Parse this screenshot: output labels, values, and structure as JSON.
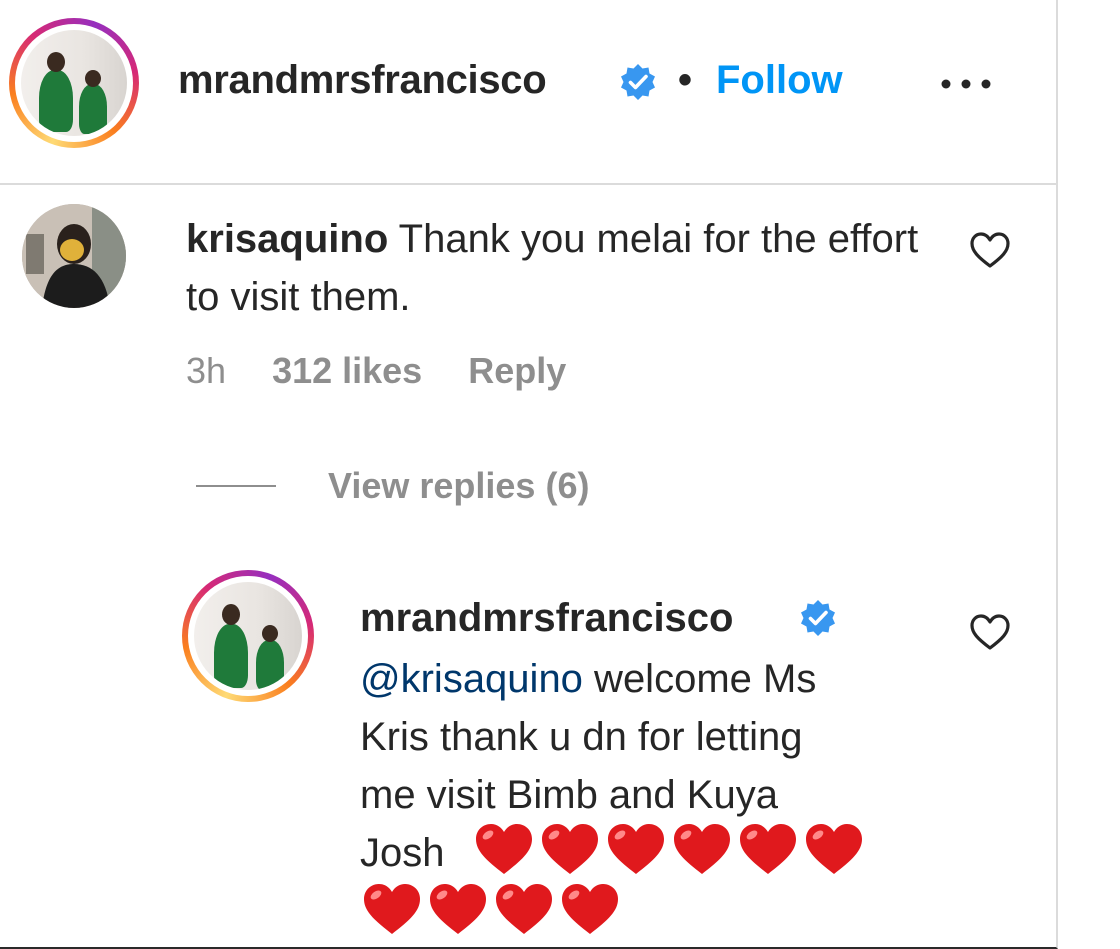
{
  "header": {
    "username": "mrandmrsfrancisco",
    "separator": "•",
    "follow_label": "Follow",
    "more_icon": "more-horizontal-icon"
  },
  "comment": {
    "username": "krisaquino",
    "text": "Thank you melai for the effort to visit them.",
    "time": "3h",
    "likes": "312 likes",
    "reply_label": "Reply",
    "view_replies_label": "View replies (6)"
  },
  "reply": {
    "username": "mrandmrsfrancisco",
    "mention": "@krisaquino",
    "text_line1_rest": " welcome Ms",
    "text_line2": "Kris thank u dn for letting",
    "text_line3": "me visit Bimb and Kuya",
    "text_line4": "Josh",
    "heart_count": 10
  },
  "colors": {
    "link_blue": "#0095f6",
    "mention_blue": "#00376b",
    "verified_blue": "#3897f0",
    "meta_gray": "#8e8e8e",
    "heart_red": "#e0191d"
  }
}
